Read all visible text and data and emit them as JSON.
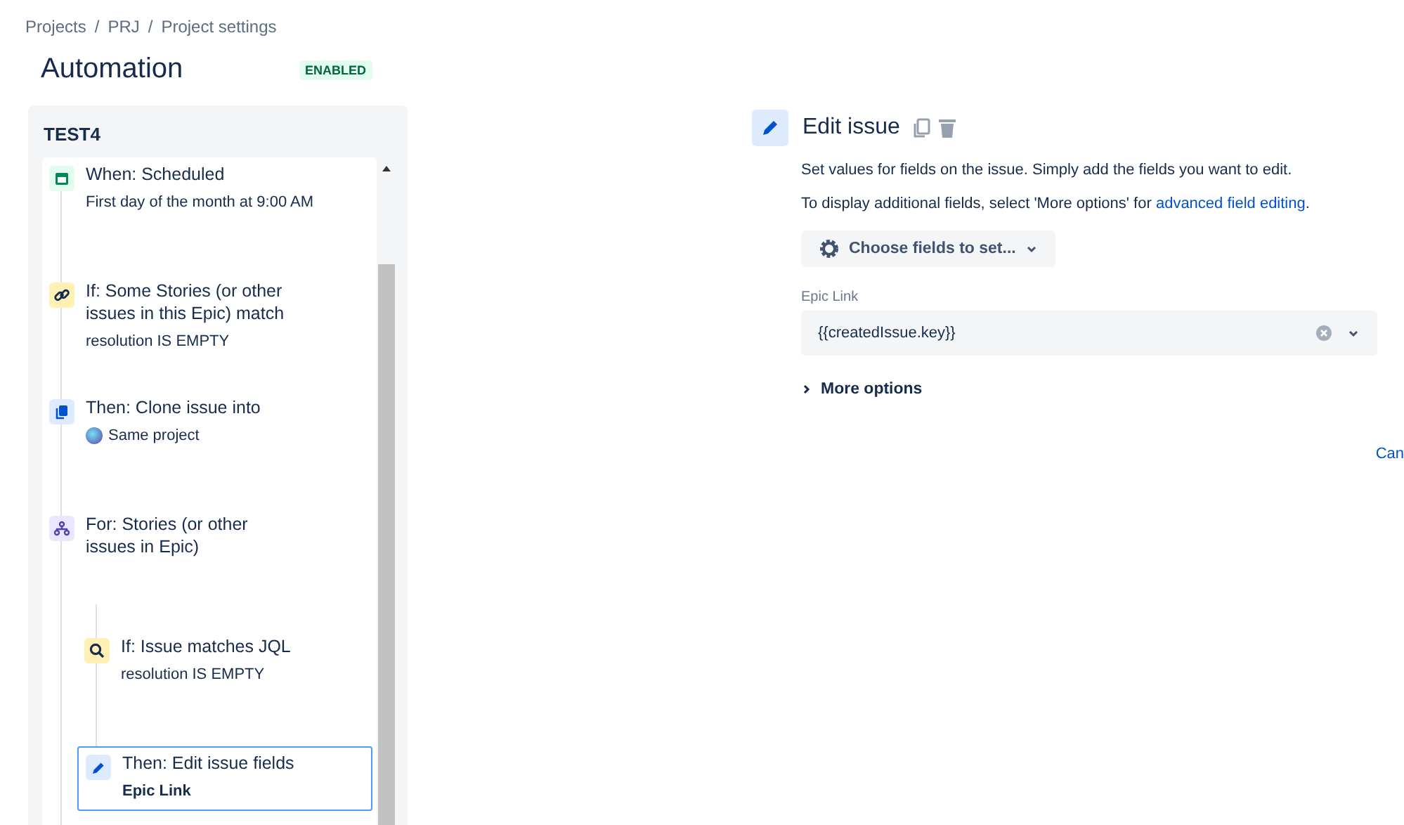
{
  "breadcrumbs": [
    "Projects",
    "PRJ",
    "Project settings"
  ],
  "breadcrumb_separator": "/",
  "page": {
    "title": "Automation",
    "status": "ENABLED"
  },
  "rule": {
    "name": "TEST4",
    "components": [
      {
        "kind": "when",
        "title": "When: Scheduled",
        "subtitle": "First day of the month at 9:00 AM",
        "subtitle_bold": false,
        "selected": false
      },
      {
        "kind": "if",
        "title": "If: Some Stories (or other issues in this Epic) match",
        "subtitle": "resolution IS EMPTY",
        "subtitle_bold": false,
        "selected": false
      },
      {
        "kind": "then",
        "title": "Then: Clone issue into",
        "subtitle": "Same project",
        "project_icon": true,
        "subtitle_bold": false,
        "selected": false
      },
      {
        "kind": "for",
        "title": "For: Stories (or other issues in Epic)",
        "selected": false,
        "children": [
          {
            "kind": "jql",
            "title": "If: Issue matches JQL",
            "subtitle": "resolution IS EMPTY",
            "subtitle_bold": false,
            "selected": false
          },
          {
            "kind": "edit",
            "title": "Then: Edit issue fields",
            "subtitle": "Epic Link",
            "subtitle_bold": true,
            "selected": true
          }
        ]
      }
    ]
  },
  "editor": {
    "title": "Edit issue",
    "description": "Set values for fields on the issue. Simply add the fields you want to edit.",
    "hint": "To display additional fields, select 'More options' for",
    "hint_link": "advanced field editing",
    "hint_end": ".",
    "choose_button": "Choose fields to set...",
    "fields": [
      {
        "label": "Epic Link",
        "value": "{{createdIssue.key}}"
      }
    ],
    "more_options": {
      "label": "More options",
      "expanded": false
    },
    "cancel": "Can"
  }
}
